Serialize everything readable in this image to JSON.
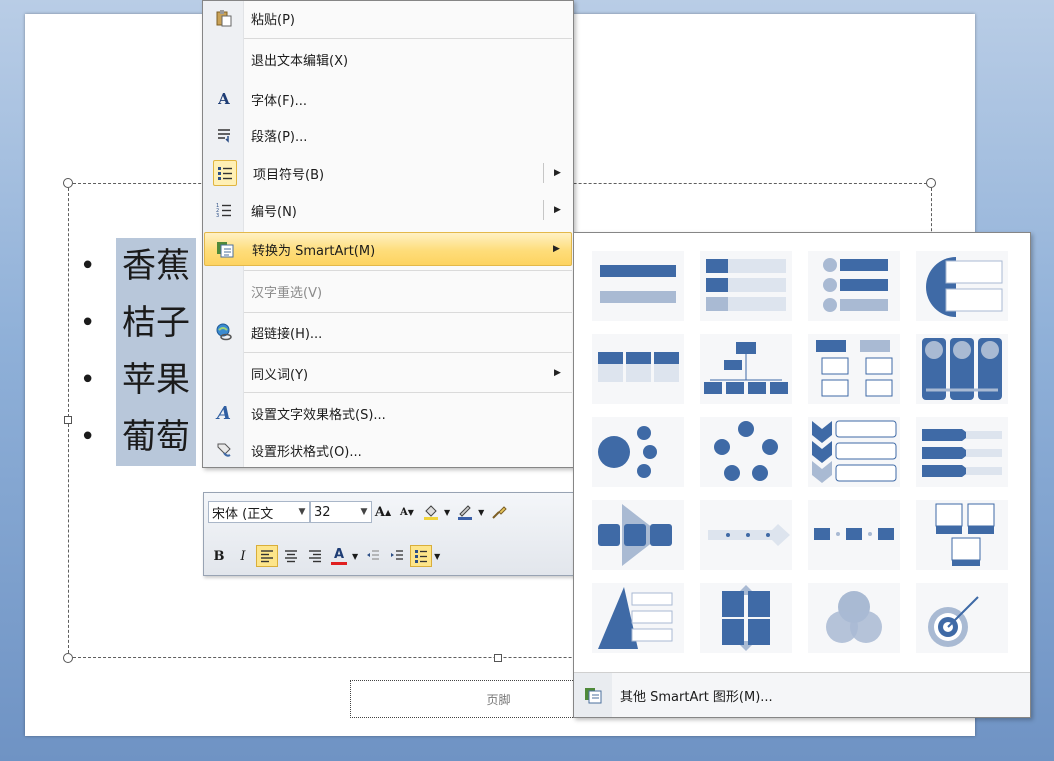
{
  "slide": {
    "bullets": [
      "香蕉",
      "桔子",
      "苹果",
      "葡萄"
    ],
    "footer": "页脚"
  },
  "context_menu": {
    "items": [
      {
        "label": "粘贴(P)",
        "icon": "paste-icon"
      },
      {
        "label": "退出文本编辑(X)",
        "icon": ""
      },
      {
        "label": "字体(F)...",
        "icon": "font-icon"
      },
      {
        "label": "段落(P)...",
        "icon": "paragraph-icon"
      },
      {
        "label": "项目符号(B)",
        "icon": "bullets-icon",
        "submenu": true
      },
      {
        "label": "编号(N)",
        "icon": "numbering-icon",
        "submenu": true
      },
      {
        "label": "转换为 SmartArt(M)",
        "icon": "smartart-icon",
        "submenu": true,
        "highlighted": true
      },
      {
        "label": "汉字重选(V)",
        "icon": "",
        "disabled": true
      },
      {
        "label": "超链接(H)...",
        "icon": "hyperlink-icon"
      },
      {
        "label": "同义词(Y)",
        "icon": "",
        "submenu": true
      },
      {
        "label": "设置文字效果格式(S)...",
        "icon": "text-effects-icon"
      },
      {
        "label": "设置形状格式(O)...",
        "icon": "shape-format-icon"
      }
    ]
  },
  "mini_toolbar": {
    "font_name": "宋体 (正文",
    "font_size": "32",
    "grow_font": "A",
    "shrink_font": "A",
    "bold": "B",
    "italic": "I",
    "font_color_letter": "A",
    "colors": {
      "highlight": "#f0d33a",
      "font_color": "#e02020",
      "outline": "#3a5fa8"
    }
  },
  "smartart_gallery": {
    "more_label": "其他 SmartArt 图形(M)...",
    "tiles": [
      "basic-block-list",
      "vertical-bullet-list",
      "vertical-circle-list",
      "trapezoid-list",
      "horizontal-list",
      "organization-chart",
      "hierarchy-list",
      "vertical-column-list",
      "radial-cluster",
      "basic-cycle",
      "vertical-chevron-list",
      "vertical-arrow-list",
      "basic-process-arrow",
      "timeline",
      "basic-chevron-process",
      "picture-list",
      "pyramid-list",
      "matrix",
      "venn",
      "target"
    ]
  },
  "colors": {
    "accent": "#3f6aa6",
    "menu_highlight": "#fddf7c",
    "selection": "#b8c7da"
  }
}
